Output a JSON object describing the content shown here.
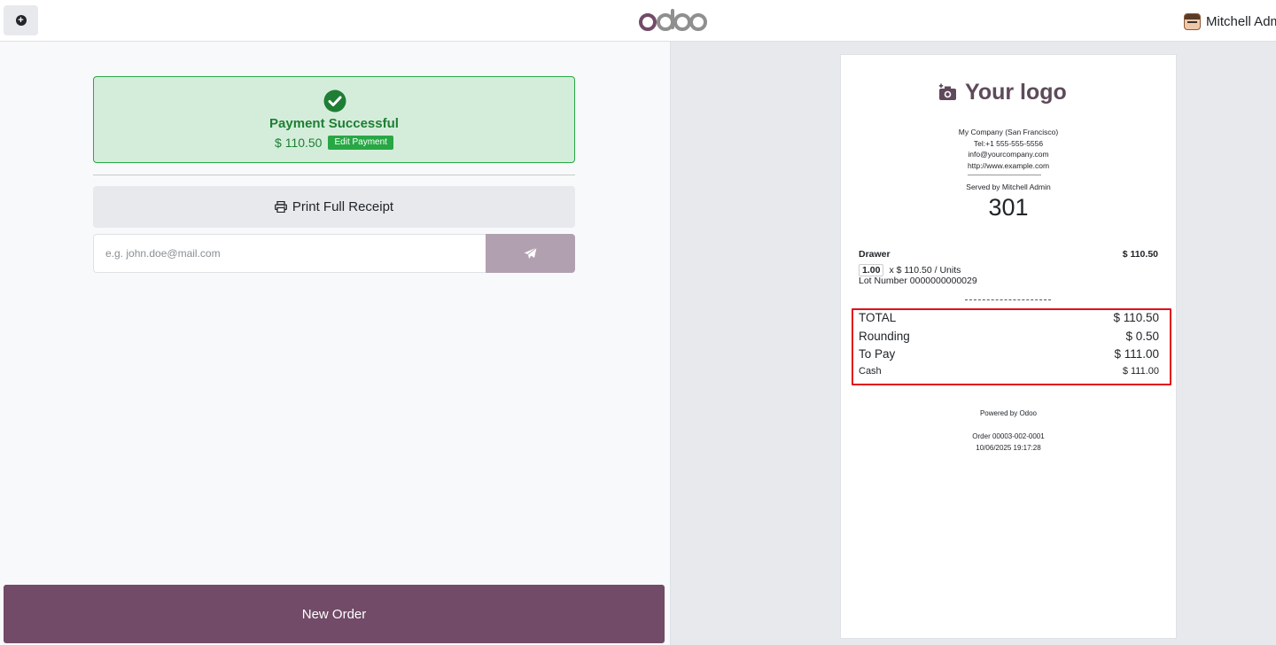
{
  "topbar": {
    "add_button_label": "+",
    "logo_text": "odoo",
    "user_name": "Mitchell Admin"
  },
  "payment": {
    "status_title": "Payment Successful",
    "amount": "$ 110.50",
    "edit_label": "Edit Payment",
    "print_label": "Print Full Receipt",
    "email_placeholder": "e.g. john.doe@mail.com",
    "email_value": "",
    "new_order_label": "New Order"
  },
  "receipt": {
    "logo_text": "Your logo",
    "company_lines": [
      "My Company (San Francisco)",
      "Tel:+1 555-555-5556",
      "info@yourcompany.com",
      "http://www.example.com"
    ],
    "served_by": "Served by Mitchell Admin",
    "ticket_number": "301",
    "line": {
      "product": "Drawer",
      "price": "$ 110.50",
      "qty": "1.00",
      "unit_price": "x $ 110.50 / Units",
      "lot": "Lot Number 0000000000029"
    },
    "totals": [
      {
        "label": "TOTAL",
        "value": "$ 110.50"
      },
      {
        "label": "Rounding",
        "value": "$ 0.50"
      },
      {
        "label": "To Pay",
        "value": "$ 111.00"
      },
      {
        "label": "Cash",
        "value": "$ 111.00"
      }
    ],
    "powered_by": "Powered by Odoo",
    "order_ref": "Order 00003-002-0001",
    "order_datetime": "10/06/2025 19:17:28"
  },
  "colors": {
    "brand": "#714b67",
    "success_bg": "#d4edda",
    "success_text": "#1e7e34",
    "highlight_border": "#e0101c"
  }
}
